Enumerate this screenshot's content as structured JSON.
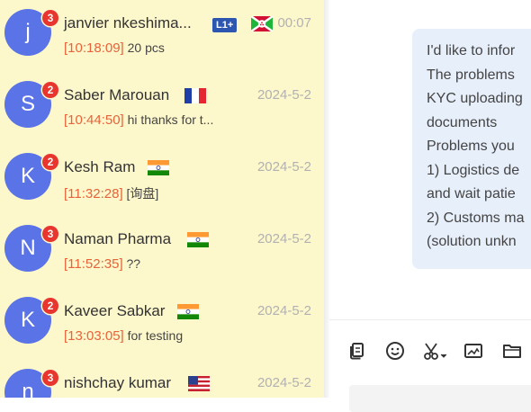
{
  "conversations": [
    {
      "initial": "j",
      "unread": "3",
      "name": "janvier nkeshima...",
      "tag": "L1+",
      "flag": "burundi",
      "date": "00:07",
      "time": "[10:18:09]",
      "message": "20 pcs"
    },
    {
      "initial": "S",
      "unread": "2",
      "name": "Saber Marouan",
      "tag": "",
      "flag": "france",
      "date": "2024-5-2",
      "time": "[10:44:50]",
      "message": "hi thanks for t..."
    },
    {
      "initial": "K",
      "unread": "2",
      "name": "Kesh Ram",
      "tag": "",
      "flag": "india",
      "date": "2024-5-2",
      "time": "[11:32:28]",
      "message": "[询盘]"
    },
    {
      "initial": "N",
      "unread": "3",
      "name": "Naman Pharma",
      "tag": "",
      "flag": "india",
      "date": "2024-5-2",
      "time": "[11:52:35]",
      "message": "??"
    },
    {
      "initial": "K",
      "unread": "2",
      "name": "Kaveer Sabkar",
      "tag": "",
      "flag": "india",
      "date": "2024-5-2",
      "time": "[13:03:05]",
      "message": "for testing"
    },
    {
      "initial": "n",
      "unread": "3",
      "name": "nishchay kumar",
      "tag": "",
      "flag": "usa",
      "date": "2024-5-2",
      "time": "",
      "message": "",
      "clipped": true
    }
  ],
  "message_bubble": {
    "lines": [
      "I'd like to infor",
      "The problems",
      "KYC uploading",
      "documents",
      "Problems you",
      "1) Logistics de",
      "and wait patie",
      "2) Customs ma",
      "(solution unkn"
    ]
  },
  "toolbar": {
    "icons": [
      "file-copy-icon",
      "emoji-icon",
      "scissors-icon",
      "image-icon",
      "folder-icon"
    ]
  },
  "colors": {
    "list_background": "#fdf7cc",
    "avatar": "#5a73e6",
    "badge": "#e8352e",
    "timestamp": "#e8633a",
    "date": "#b1b1b1",
    "bubble": "#e7effb",
    "tag": "#2d56b0"
  }
}
